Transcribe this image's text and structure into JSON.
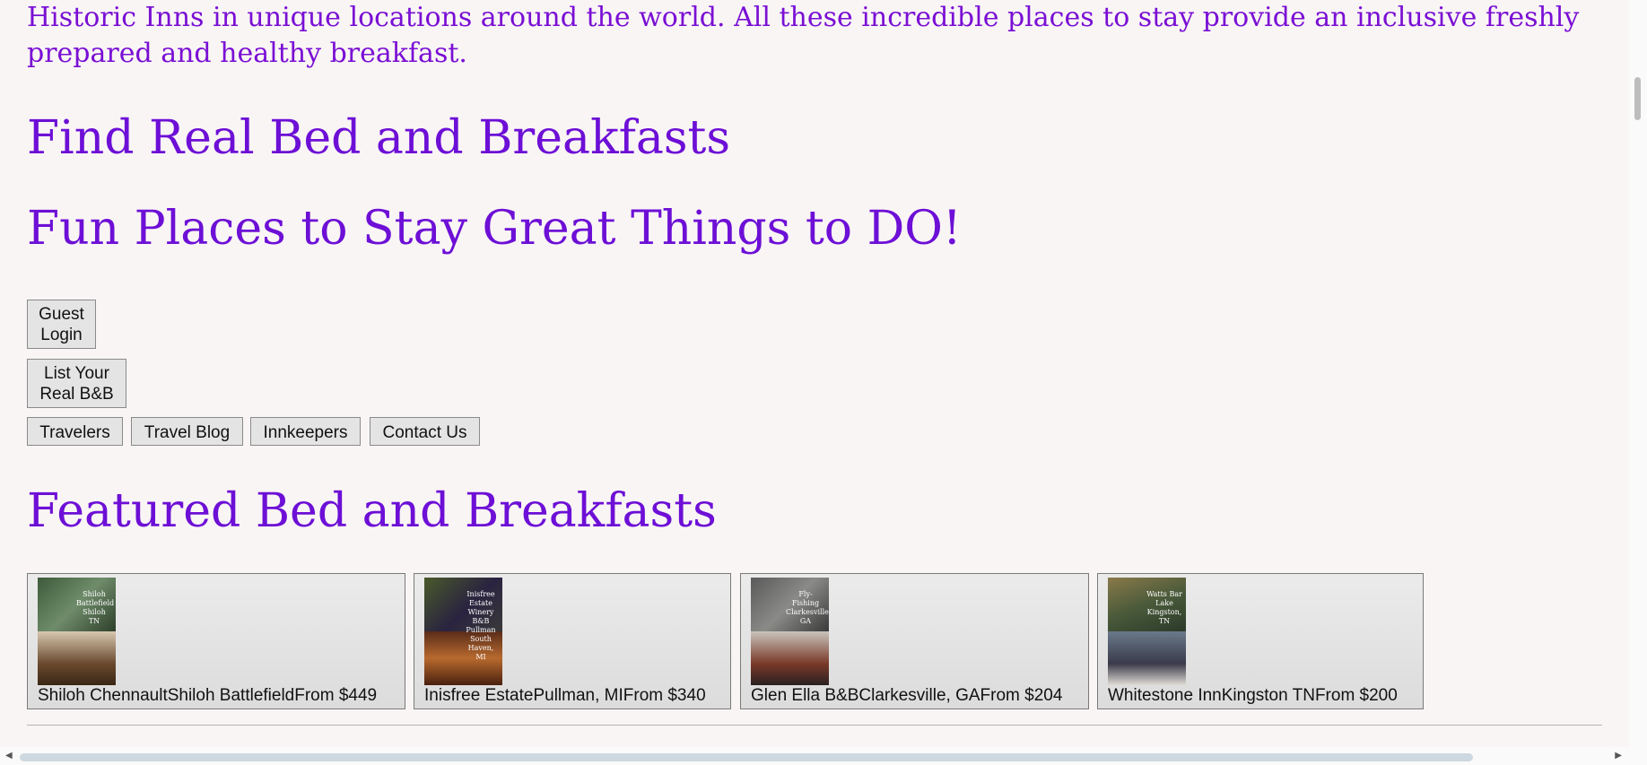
{
  "intro": {
    "text": "Historic Inns in unique locations around the world. All these incredible places to stay provide an inclusive freshly prepared and healthy breakfast."
  },
  "headings": {
    "find": "Find Real Bed and Breakfasts",
    "fun": "Fun Places to Stay Great Things to DO!",
    "featured": "Featured Bed and Breakfasts"
  },
  "buttons": {
    "guest_login": "Guest Login",
    "list_bnb": "List Your Real B&B"
  },
  "nav": [
    {
      "label": "Travelers"
    },
    {
      "label": "Travel Blog"
    },
    {
      "label": "Innkeepers"
    },
    {
      "label": "Contact Us"
    }
  ],
  "featured": [
    {
      "label": "Shiloh ChennaultShiloh BattlefieldFrom $449",
      "caption": "Shiloh Battlefield Shiloh TN"
    },
    {
      "label": "Inisfree EstatePullman, MIFrom $340",
      "caption": "Inisfree Estate Winery B&B Pullman South Haven, MI"
    },
    {
      "label": "Glen Ella B&BClarkesville, GAFrom $204",
      "caption": "Fly-Fishing Clarkesville, GA"
    },
    {
      "label": "Whitestone InnKingston TNFrom $200",
      "caption": "Watts Bar Lake Kingston, TN"
    }
  ],
  "colors": {
    "heading": "#6d0fd6",
    "background": "#f9f5f5"
  }
}
